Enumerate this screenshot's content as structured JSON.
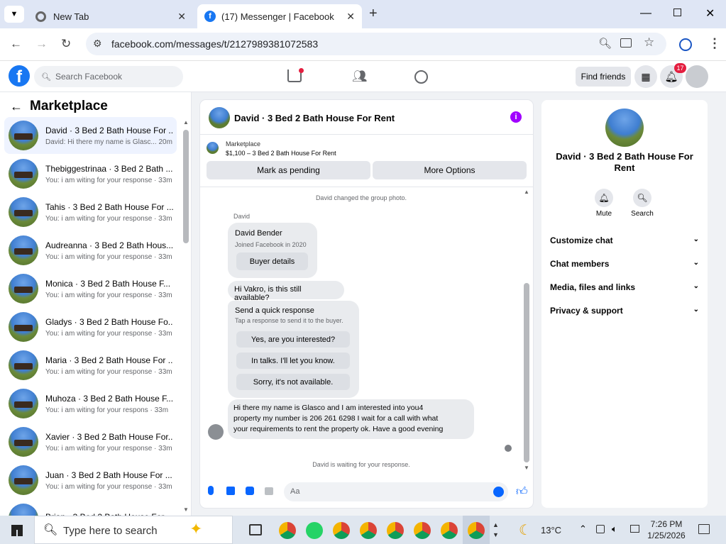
{
  "browser": {
    "tabs": [
      {
        "title": "New Tab",
        "active": false
      },
      {
        "title": "(17) Messenger | Facebook",
        "active": true
      }
    ],
    "url": "facebook.com/messages/t/2127989381072583"
  },
  "fb_header": {
    "search_placeholder": "Search Facebook",
    "find_friends": "Find friends",
    "notification_count": "17"
  },
  "sidebar": {
    "title": "Marketplace",
    "conversations": [
      {
        "name": "David · 3 Bed 2 Bath House For ...",
        "preview": "David: Hi there my name is Glasc... 20m",
        "selected": true
      },
      {
        "name": "Thebiggestrinaa · 3 Bed 2 Bath ...",
        "preview": "You: i am witing for your response · 33m"
      },
      {
        "name": "Tahis · 3 Bed 2 Bath House For ...",
        "preview": "You: i am witing for your response · 33m"
      },
      {
        "name": "Audreanna · 3 Bed 2 Bath Hous...",
        "preview": "You: i am witing for your response · 33m"
      },
      {
        "name": "Monica · 3 Bed 2 Bath House F...",
        "preview": "You: i am witing for your response · 33m"
      },
      {
        "name": "Gladys · 3 Bed 2 Bath House Fo...",
        "preview": "You: i am witing for your response · 33m"
      },
      {
        "name": "Maria · 3 Bed 2 Bath House For ...",
        "preview": "You: i am witing for your response · 33m"
      },
      {
        "name": "Muhoza · 3 Bed 2 Bath House F...",
        "preview": "You: i am witing for your respons · 33m"
      },
      {
        "name": "Xavier · 3 Bed 2 Bath House For...",
        "preview": "You: i am witing for your response · 33m"
      },
      {
        "name": "Juan · 3 Bed 2 Bath House For ...",
        "preview": "You: i am witing for your response · 33m"
      },
      {
        "name": "Brian · 3 Bed 2 Bath House For ...",
        "preview": ""
      }
    ]
  },
  "chat": {
    "title": "David · 3 Bed 2 Bath House For Rent",
    "listing_source": "Marketplace",
    "listing_desc": "$1,100 – 3 Bed 2 Bath House For Rent",
    "mark_pending": "Mark as pending",
    "more_options": "More Options",
    "system_msg_1": "David changed the group photo.",
    "sender_label": "David",
    "profile_name": "David Bender",
    "profile_joined": "Joined Facebook in 2020",
    "buyer_details": "Buyer details",
    "msg_available": "Hi Vakro, is this still available?",
    "quick_title": "Send a quick response",
    "quick_sub": "Tap a response to send it to the buyer.",
    "quick_1": "Yes, are you interested?",
    "quick_2": "In talks. I'll let you know.",
    "quick_3": "Sorry, it's not available.",
    "msg_long_1": "Hi there my name is Glasco and I am interested into you4",
    "msg_long_2": "property my number is 206 261 6298 I wait for a call with what",
    "msg_long_3": "your requirements to rent the property ok. Have a good evening",
    "system_msg_2": "David is waiting for your response.",
    "composer_placeholder": "Aa"
  },
  "right_panel": {
    "name": "David · 3 Bed 2 Bath House For Rent",
    "mute": "Mute",
    "search": "Search",
    "rows": [
      "Customize chat",
      "Chat members",
      "Media, files and links",
      "Privacy & support"
    ]
  },
  "taskbar": {
    "search_text": "Type here to search",
    "weather": "13°C",
    "time": "7:26 PM",
    "date": "1/25/2026"
  },
  "colors": {
    "fb_blue": "#1877f2",
    "notif_red": "#e41e3f",
    "info_purple": "#a100ff"
  }
}
